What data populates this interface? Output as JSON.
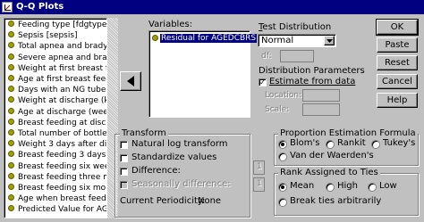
{
  "window": {
    "title": "Q-Q Plots"
  },
  "source_list": {
    "items": [
      "Feeding type [fdgtype]",
      "Sepsis [sepsis]",
      "Total apnea and brady",
      "Severe apnea and brad",
      "Weight at first breast fe",
      "Age at first breast feed",
      "Days with an NG tube [",
      "Weight at discharge (k",
      "Age at discharge (wee",
      "Breast feeding at disc",
      "Total number of bottles",
      "Weight 3 days after dis",
      "Breast feeding 3 days",
      "Breast feeding six wee",
      "Breast feeding three m",
      "Breast feeding six mon",
      "Age when breast feedi",
      "Predicted Value for AG"
    ]
  },
  "variables": {
    "label": "Variables:",
    "items": [
      "Residual for AGEDCBRS"
    ]
  },
  "transfer_button": {
    "icon": "left-arrow-icon"
  },
  "test_distribution": {
    "label": "Test Distribution",
    "selected": "Normal",
    "df_label": "df:"
  },
  "distribution_parameters": {
    "label": "Distribution Parameters",
    "estimate_label": "Estimate from data",
    "estimate_checked": true,
    "location_label": "Location:",
    "scale_label": "Scale:"
  },
  "buttons": {
    "ok": "OK",
    "paste": "Paste",
    "reset": "Reset",
    "cancel": "Cancel",
    "help": "Help"
  },
  "transform": {
    "label": "Transform",
    "natural_log": "Natural log transform",
    "standardize": "Standardize values",
    "difference": "Difference:",
    "seasonal_difference": "Seasonally difference:",
    "periodicity_label": "Current Periodicity:",
    "periodicity_value": "None",
    "difference_value": "1",
    "seasonal_value": "1"
  },
  "proportion_estimation": {
    "label": "Proportion Estimation Formula",
    "options": [
      "Blom's",
      "Rankit",
      "Tukey's",
      "Van der Waerden's"
    ],
    "selected": "Blom's"
  },
  "rank_ties": {
    "label": "Rank Assigned to Ties",
    "options": [
      "Mean",
      "High",
      "Low",
      "Break ties arbitrarily"
    ],
    "selected": "Mean"
  }
}
